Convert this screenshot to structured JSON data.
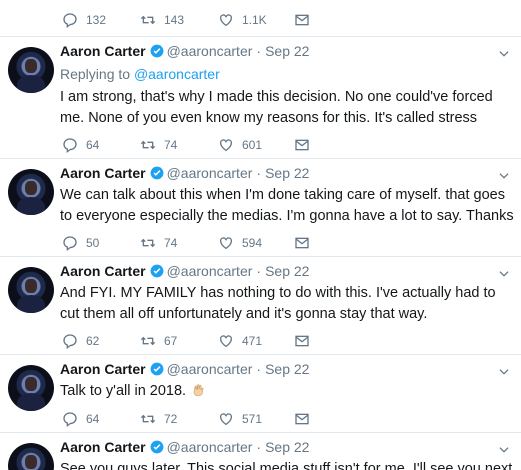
{
  "top_actions": {
    "replies": "132",
    "retweets": "143",
    "likes": "1.1K"
  },
  "tweets": [
    {
      "name": "Aaron Carter",
      "handle": "@aaroncarter",
      "dot": "·",
      "date": "Sep 22",
      "replying_prefix": "Replying to ",
      "replying_handle": "@aaroncarter",
      "text": "I am strong, that's why I made this decision. No one could've forced me. None of you even know my reasons for this. It's called stress",
      "replies": "64",
      "retweets": "74",
      "likes": "601"
    },
    {
      "name": "Aaron Carter",
      "handle": "@aaroncarter",
      "dot": "·",
      "date": "Sep 22",
      "text": "We can talk about this when I'm done taking care of myself. that goes to everyone especially the medias. I'm gonna have a lot to say. Thanks",
      "replies": "50",
      "retweets": "74",
      "likes": "594"
    },
    {
      "name": "Aaron Carter",
      "handle": "@aaroncarter",
      "dot": "·",
      "date": "Sep 22",
      "text": "And FYI. MY FAMILY has nothing to do with this. I've actually had to cut them all off unfortunately and it's gonna stay that way.",
      "replies": "62",
      "retweets": "67",
      "likes": "471"
    },
    {
      "name": "Aaron Carter",
      "handle": "@aaroncarter",
      "dot": "·",
      "date": "Sep 22",
      "text": "Talk to y'all in 2018.",
      "emoji": "ok-hand-emoji",
      "replies": "64",
      "retweets": "72",
      "likes": "571"
    },
    {
      "name": "Aaron Carter",
      "handle": "@aaroncarter",
      "dot": "·",
      "date": "Sep 22",
      "text": "See you guys later. This social media stuff isn't for me. I'll see you next"
    }
  ],
  "colors": {
    "accent": "#1da1f2",
    "muted": "#657786",
    "text": "#14171a",
    "border": "#e1e8ed"
  }
}
